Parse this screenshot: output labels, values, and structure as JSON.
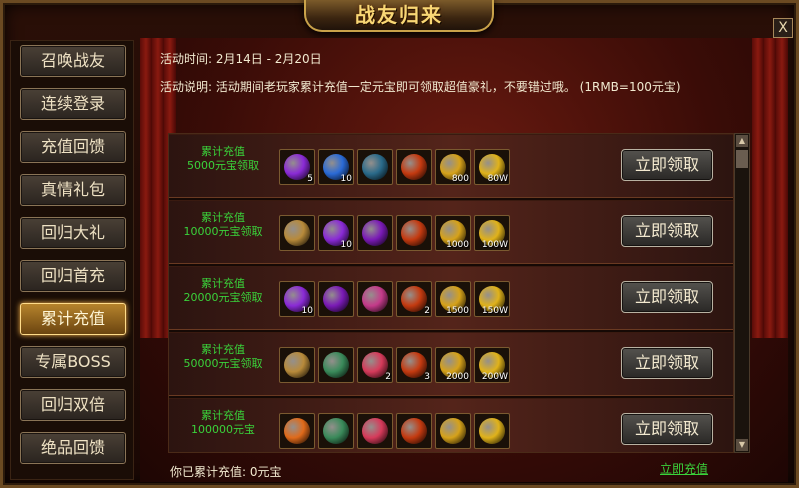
{
  "window": {
    "title": "战友归来",
    "close_label": "X"
  },
  "sidebar": {
    "items": [
      {
        "label": "召唤战友"
      },
      {
        "label": "连续登录"
      },
      {
        "label": "充值回馈"
      },
      {
        "label": "真情礼包"
      },
      {
        "label": "回归大礼"
      },
      {
        "label": "回归首充"
      },
      {
        "label": "累计充值",
        "active": true
      },
      {
        "label": "专属BOSS"
      },
      {
        "label": "回归双倍"
      },
      {
        "label": "绝品回馈"
      }
    ]
  },
  "info": {
    "time": "活动时间: 2月14日 - 2月20日",
    "desc": "活动说明: 活动期间老玩家累计充值一定元宝即可领取超值豪礼，不要错过哦。 (1RMB=100元宝)"
  },
  "rows": [
    {
      "label": "累计充值\n5000元宝领取",
      "button": "立即领取",
      "items": [
        {
          "icon": "purple-gem-icon",
          "color": "#8a2ad6",
          "count": "5"
        },
        {
          "icon": "blue-orb-icon",
          "color": "#2a6ad6",
          "count": "10"
        },
        {
          "icon": "skillbook-icon",
          "color": "#2a6a8a",
          "count": ""
        },
        {
          "icon": "red-orb-icon",
          "color": "#c43a10",
          "count": ""
        },
        {
          "icon": "gold-ingot-icon",
          "color": "#d6a21a",
          "count": "800"
        },
        {
          "icon": "gold-pile-icon",
          "color": "#e0b21a",
          "count": "80W"
        }
      ]
    },
    {
      "label": "累计充值\n10000元宝领取",
      "button": "立即领取",
      "items": [
        {
          "icon": "treasure-chest-icon",
          "color": "#b88a3a",
          "count": ""
        },
        {
          "icon": "purple-gem-icon",
          "color": "#8a2ad6",
          "count": "10"
        },
        {
          "icon": "purple-orb-icon",
          "color": "#7a1ab6",
          "count": ""
        },
        {
          "icon": "red-orb-icon",
          "color": "#c43a10",
          "count": ""
        },
        {
          "icon": "gold-ingot-icon",
          "color": "#d6a21a",
          "count": "1000"
        },
        {
          "icon": "gold-pile-icon",
          "color": "#e0b21a",
          "count": "100W"
        }
      ]
    },
    {
      "label": "累计充值\n20000元宝领取",
      "button": "立即领取",
      "items": [
        {
          "icon": "purple-gem-icon",
          "color": "#8a2ad6",
          "count": "10"
        },
        {
          "icon": "purple-orb-icon",
          "color": "#7a1ab6",
          "count": ""
        },
        {
          "icon": "pink-armor-icon",
          "color": "#c43a8a",
          "count": ""
        },
        {
          "icon": "red-orb-icon",
          "color": "#c43a10",
          "count": "2"
        },
        {
          "icon": "gold-ingot-icon",
          "color": "#d6a21a",
          "count": "1500"
        },
        {
          "icon": "gold-pile-icon",
          "color": "#e0b21a",
          "count": "150W"
        }
      ]
    },
    {
      "label": "累计充值\n50000元宝领取",
      "button": "立即领取",
      "items": [
        {
          "icon": "treasure-chest-icon",
          "color": "#b88a3a",
          "count": ""
        },
        {
          "icon": "jade-chest-icon",
          "color": "#3a8a5a",
          "count": ""
        },
        {
          "icon": "feather-icon",
          "color": "#d63a5a",
          "count": "2"
        },
        {
          "icon": "red-orb-icon",
          "color": "#c43a10",
          "count": "3"
        },
        {
          "icon": "gold-ingot-icon",
          "color": "#d6a21a",
          "count": "2000"
        },
        {
          "icon": "gold-pile-icon",
          "color": "#e0b21a",
          "count": "200W"
        }
      ]
    },
    {
      "label": "累计充值\n100000元宝",
      "button": "立即领取",
      "items": [
        {
          "icon": "flame-icon",
          "color": "#e06a1a",
          "count": ""
        },
        {
          "icon": "jade-chest-icon",
          "color": "#3a8a5a",
          "count": ""
        },
        {
          "icon": "feather-icon",
          "color": "#d63a5a",
          "count": ""
        },
        {
          "icon": "red-orb-icon",
          "color": "#c43a10",
          "count": ""
        },
        {
          "icon": "gold-ingot-icon",
          "color": "#d6a21a",
          "count": ""
        },
        {
          "icon": "gold-pile-icon",
          "color": "#e0b21a",
          "count": ""
        }
      ]
    }
  ],
  "footer": {
    "total": "你已累计充值: 0元宝",
    "recharge_label": "立即充值"
  }
}
